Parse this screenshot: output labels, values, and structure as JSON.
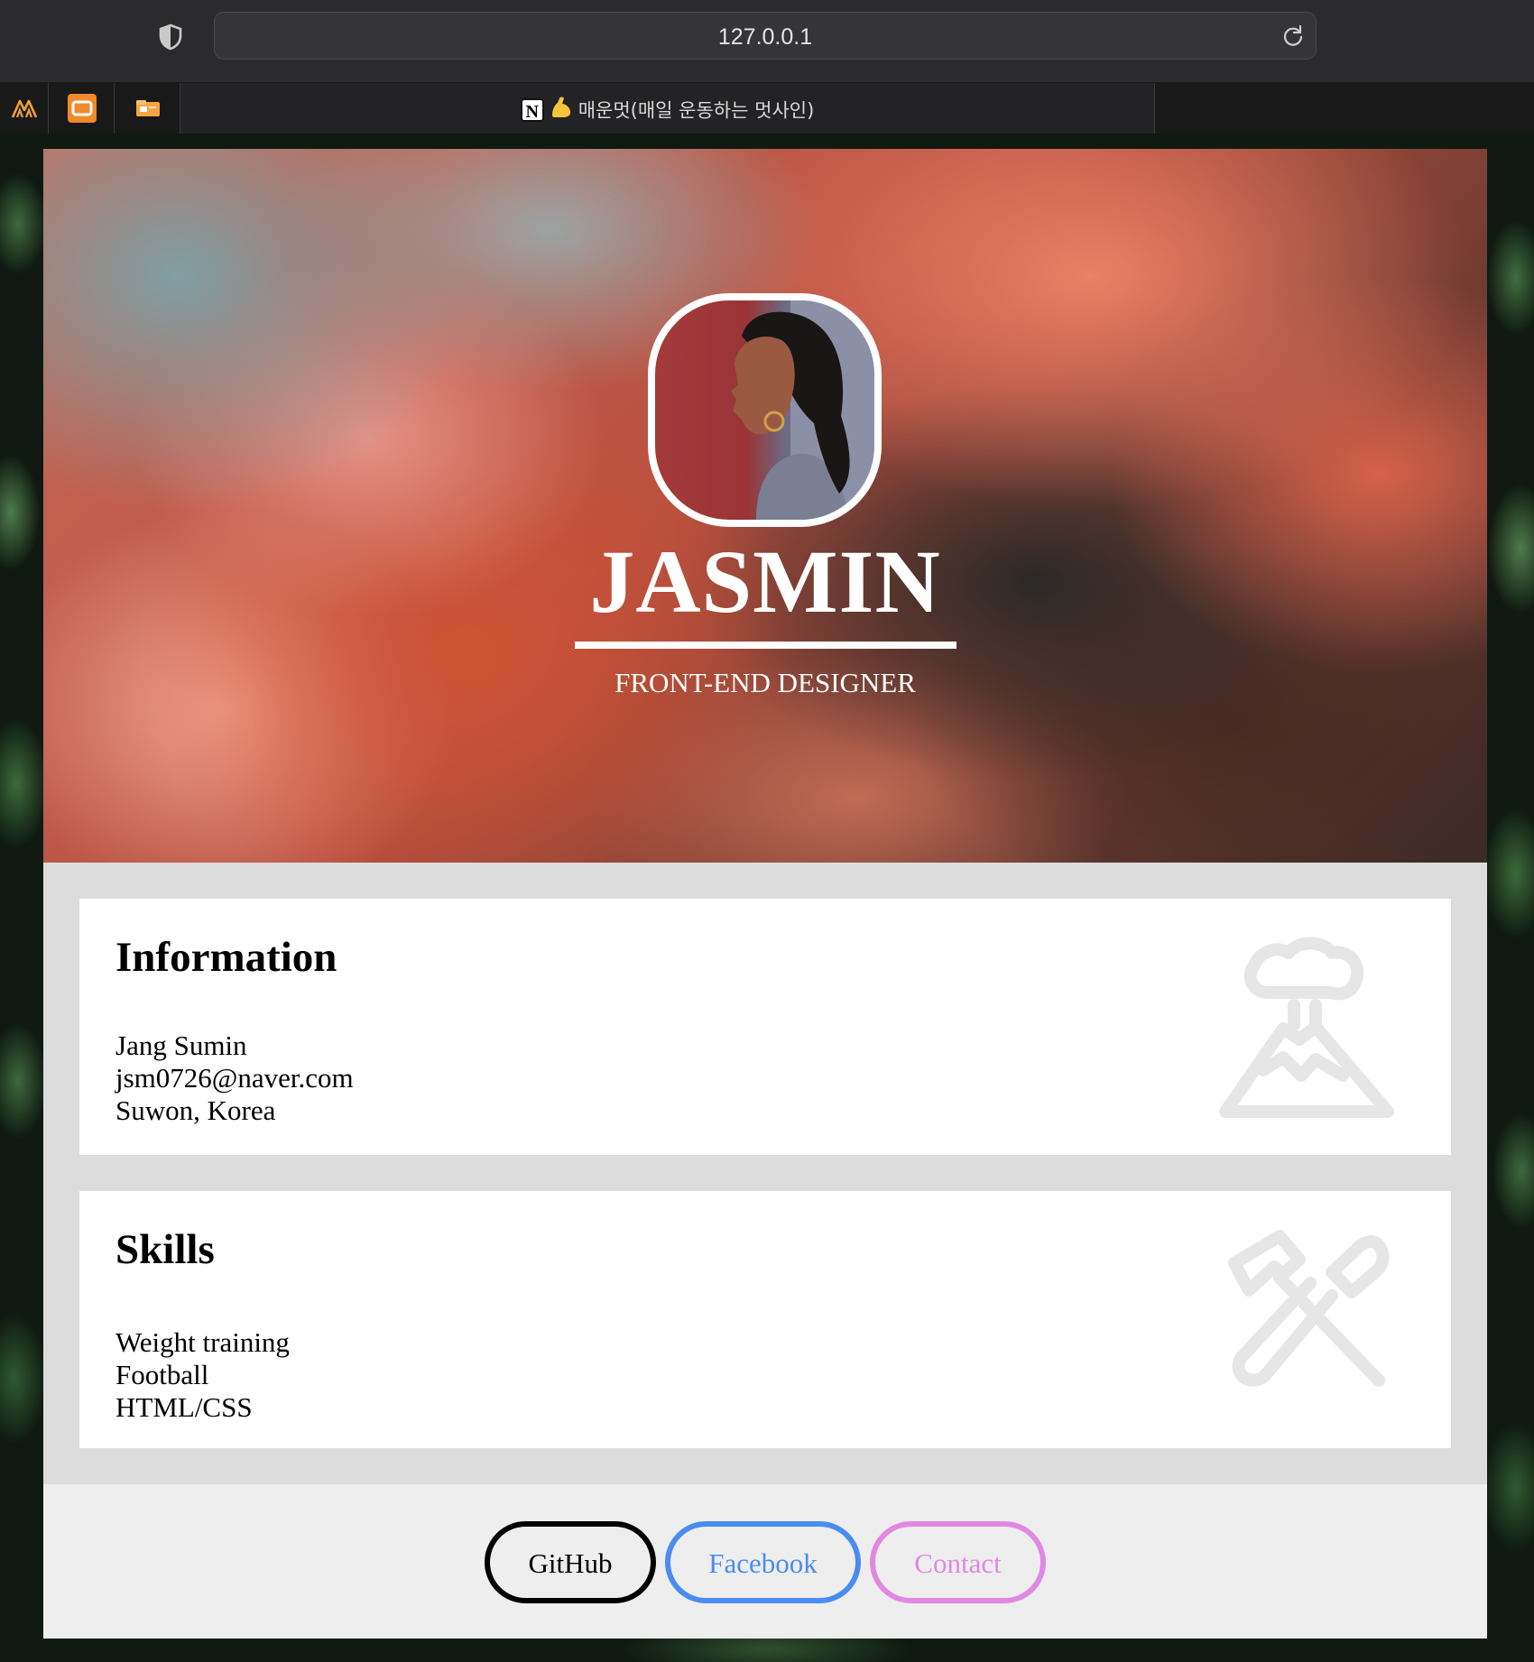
{
  "browser": {
    "url": "127.0.0.1",
    "active_tab_title": "매운멋(매일 운동하는 멋사인)",
    "icons": [
      "shield-icon",
      "reload-icon",
      "mountain-logo-icon",
      "orange-app-icon",
      "card-folder-icon",
      "notion-icon",
      "flexed-biceps-icon"
    ]
  },
  "profile": {
    "name": "JASMIN",
    "role": "FRONT-END DESIGNER"
  },
  "information": {
    "title": "Information",
    "lines": [
      "Jang Sumin",
      "jsm0726@naver.com",
      "Suwon, Korea"
    ],
    "icon": "volcano-icon"
  },
  "skills": {
    "title": "Skills",
    "lines": [
      "Weight training",
      "Football",
      "HTML/CSS"
    ],
    "icon": "hammer-wrench-icon"
  },
  "buttons": {
    "github": "GitHub",
    "facebook": "Facebook",
    "contact": "Contact"
  },
  "colors": {
    "github": "#000000",
    "facebook": "#4a8cf0",
    "contact": "#e088e2",
    "card_bg": "#dcdcdc",
    "footer_bg": "#eeeeee"
  }
}
